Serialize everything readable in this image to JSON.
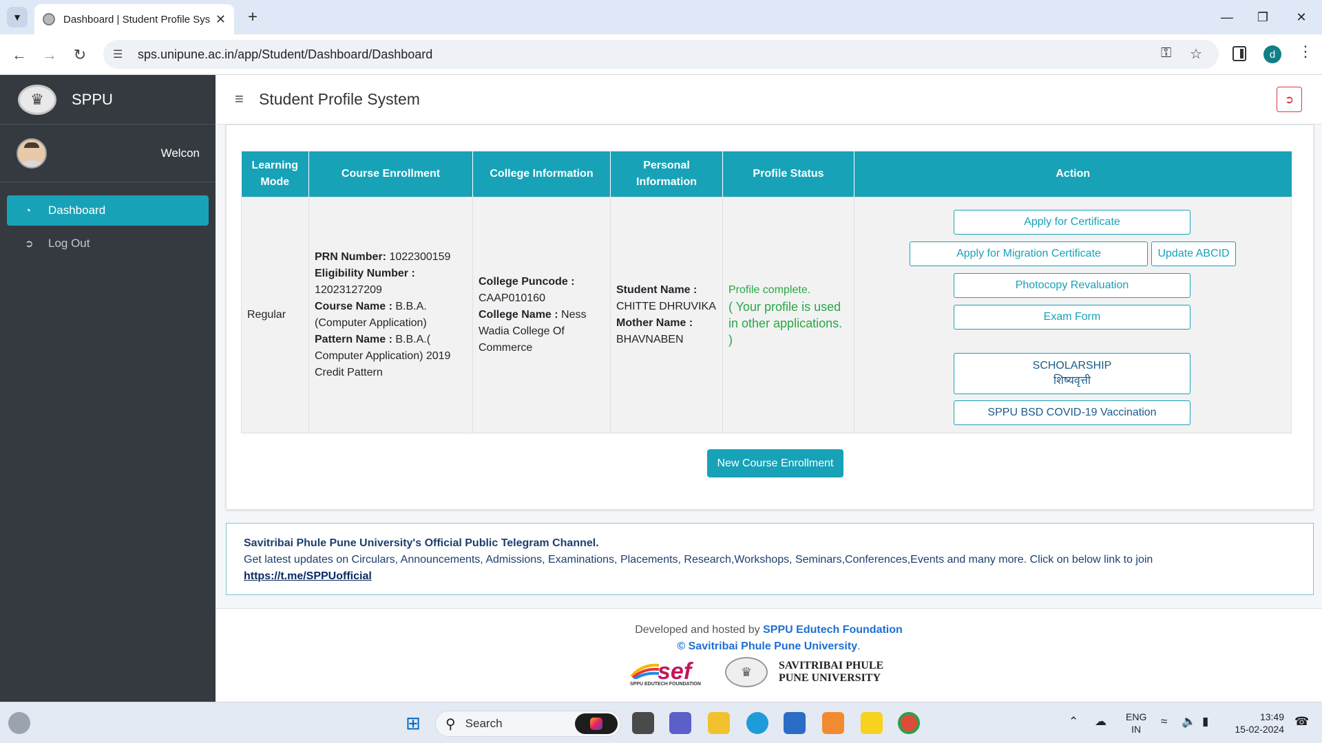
{
  "browser": {
    "tab_title": "Dashboard | Student Profile Sys",
    "url": "sps.unipune.ac.in/app/Student/Dashboard/Dashboard",
    "profile_initial": "d"
  },
  "sidebar": {
    "brand": "SPPU",
    "welcome": "Welcon",
    "items": [
      {
        "label": "Dashboard",
        "active": true,
        "icon": "dashboard-icon"
      },
      {
        "label": "Log Out",
        "active": false,
        "icon": "sign-out-icon"
      }
    ]
  },
  "header": {
    "title": "Student Profile System"
  },
  "table": {
    "headers": [
      "Learning Mode",
      "Course Enrollment",
      "College Information",
      "Personal Information",
      "Profile Status",
      "Action"
    ],
    "row": {
      "learning_mode": "Regular",
      "course": {
        "prn_label": "PRN Number:",
        "prn_value": " 1022300159",
        "elig_label": "Eligibility Number :",
        "elig_value": " 12023127209",
        "course_label": "Course Name :",
        "course_value": " B.B.A. (Computer Application)",
        "pattern_label": "Pattern Name :",
        "pattern_value": " B.B.A.( Computer Application) 2019 Credit Pattern"
      },
      "college": {
        "puncode_label": "College Puncode :",
        "puncode_value": " CAAP010160",
        "name_label": "College Name :",
        "name_value": " Ness Wadia College Of Commerce"
      },
      "personal": {
        "student_label": "Student Name :",
        "student_value": " CHITTE DHRUVIKA",
        "mother_label": "Mother Name :",
        "mother_value": " BHAVNABEN"
      },
      "status": {
        "line1": "Profile complete.",
        "line2": "( Your profile is used in other applications. )"
      },
      "actions": {
        "apply_certificate": "Apply for Certificate",
        "apply_migration": "Apply for Migration Certificate",
        "update_abcid": "Update ABCID",
        "photocopy": "Photocopy Revaluation",
        "exam_form": "Exam Form",
        "scholarship_en": "SCHOLARSHIP",
        "scholarship_mr": "शिष्यवृत्ती",
        "covid": "SPPU BSD COVID-19 Vaccination"
      }
    }
  },
  "new_enrollment_label": "New Course Enrollment",
  "telegram": {
    "title": "Savitribai Phule Pune University's Official Public Telegram Channel.",
    "description": "Get latest updates on Circulars, Announcements, Admissions, Examinations, Placements, Research,Workshops, Seminars,Conferences,Events and many more. Click on below link to join",
    "link": "https://t.me/SPPUofficial"
  },
  "footer": {
    "developed_prefix": "Developed and hosted by ",
    "developed_by": "SPPU Edutech Foundation",
    "copyright_symbol": "© ",
    "university": "Savitribai Phule Pune University",
    "period": ".",
    "sef_logo_text": "sef",
    "sef_logo_sub": "SPPU EDUTECH FOUNDATION",
    "sppu_logo_line1": "SAVITRIBAI PHULE",
    "sppu_logo_line2": "PUNE UNIVERSITY"
  },
  "taskbar": {
    "search_label": "Search",
    "lang_line1": "ENG",
    "lang_line2": "IN",
    "time": "13:49",
    "date": "15-02-2024"
  },
  "colors": {
    "accent": "#17a2b8",
    "sidebar": "#343a40",
    "success": "#28a745",
    "danger": "#dc3545"
  }
}
